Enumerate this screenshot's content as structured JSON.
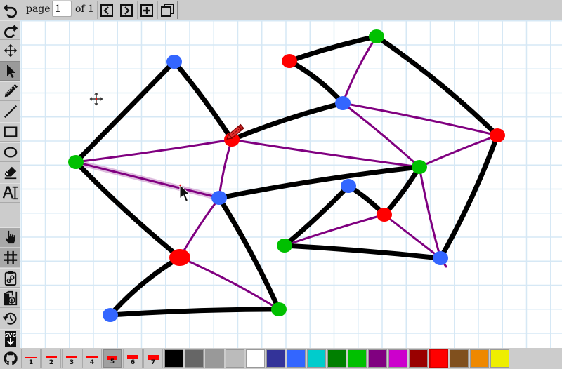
{
  "app": {
    "canvas_background": "#ffffff",
    "grid_color": "#d6e8f5"
  },
  "topbar": {
    "undo_icon": "undo-icon",
    "page_label": "page",
    "page_value": "1",
    "of_label": "of 1",
    "buttons": [
      {
        "name": "previous-page",
        "icon": "chevron-left-icon"
      },
      {
        "name": "next-page",
        "icon": "chevron-right-icon"
      },
      {
        "name": "add-page",
        "icon": "plus-icon"
      },
      {
        "name": "duplicate-page",
        "icon": "copy-icon"
      }
    ]
  },
  "tools": [
    {
      "name": "redo",
      "icon": "redo-icon",
      "state": "normal"
    },
    {
      "name": "pan",
      "icon": "move-icon",
      "state": "normal"
    },
    {
      "name": "select",
      "icon": "pointer-icon",
      "state": "active"
    },
    {
      "name": "pen",
      "icon": "pencil-icon",
      "state": "normal"
    },
    {
      "name": "line",
      "icon": "line-icon",
      "state": "normal"
    },
    {
      "name": "rectangle",
      "icon": "rectangle-icon",
      "state": "normal"
    },
    {
      "name": "ellipse",
      "icon": "ellipse-icon",
      "state": "normal"
    },
    {
      "name": "eraser",
      "icon": "eraser-icon",
      "state": "normal"
    },
    {
      "name": "text",
      "icon": "text-icon",
      "state": "normal"
    },
    {
      "name": "touch-draw",
      "icon": "hand-pointer-icon",
      "state": "toggled"
    },
    {
      "name": "grid",
      "icon": "grid-icon",
      "state": "toggled"
    },
    {
      "name": "share-link",
      "icon": "clipboard-link-icon",
      "state": "normal"
    },
    {
      "name": "add-image",
      "icon": "image-add-icon",
      "state": "normal"
    },
    {
      "name": "history",
      "icon": "history-icon",
      "state": "normal"
    },
    {
      "name": "export-svg",
      "icon": "svg-download-icon",
      "state": "normal",
      "label": "SVG"
    }
  ],
  "bottombar": {
    "github_icon": "github-icon",
    "stroke_widths": [
      {
        "label": "1",
        "active": false
      },
      {
        "label": "2",
        "active": false
      },
      {
        "label": "3",
        "active": false
      },
      {
        "label": "4",
        "active": false
      },
      {
        "label": "5",
        "active": true
      },
      {
        "label": "6",
        "active": false
      },
      {
        "label": "7",
        "active": false
      }
    ],
    "stroke_preview_color": "#ff0000",
    "colors": [
      {
        "hex": "#000000",
        "active": false
      },
      {
        "hex": "#666666",
        "active": false
      },
      {
        "hex": "#999999",
        "active": false
      },
      {
        "hex": "#bbbbbb",
        "active": false
      },
      {
        "hex": "#ffffff",
        "active": false
      },
      {
        "hex": "#333399",
        "active": false
      },
      {
        "hex": "#3366ff",
        "active": false
      },
      {
        "hex": "#00cccc",
        "active": false
      },
      {
        "hex": "#007f00",
        "active": false
      },
      {
        "hex": "#00c000",
        "active": false
      },
      {
        "hex": "#800080",
        "active": false
      },
      {
        "hex": "#cc00cc",
        "active": false
      },
      {
        "hex": "#990000",
        "active": false
      },
      {
        "hex": "#ff0000",
        "active": true
      },
      {
        "hex": "#80501e",
        "active": false
      },
      {
        "hex": "#ee8800",
        "active": false
      },
      {
        "hex": "#eeee00",
        "active": false
      }
    ]
  },
  "drawing": {
    "nodes": [
      {
        "id": "n1",
        "color": "#3366ff"
      },
      {
        "id": "n2",
        "color": "#00c000"
      },
      {
        "id": "n3",
        "color": "#ff0000"
      },
      {
        "id": "n4",
        "color": "#3366ff"
      },
      {
        "id": "n5",
        "color": "#ff0000"
      },
      {
        "id": "n6",
        "color": "#3366ff"
      },
      {
        "id": "n7",
        "color": "#00c000"
      },
      {
        "id": "n8",
        "color": "#ff0000"
      },
      {
        "id": "n9",
        "color": "#00c000"
      },
      {
        "id": "n10",
        "color": "#3366ff"
      },
      {
        "id": "n11",
        "color": "#ff0000"
      },
      {
        "id": "n12",
        "color": "#00c000"
      },
      {
        "id": "n13",
        "color": "#3366ff"
      },
      {
        "id": "n14",
        "color": "#ff0000"
      },
      {
        "id": "n15",
        "color": "#00c000"
      },
      {
        "id": "n16",
        "color": "#3366ff"
      }
    ],
    "black_edges": [
      [
        "n1",
        "n2"
      ],
      [
        "n1",
        "n3"
      ],
      [
        "n2",
        "n5"
      ],
      [
        "n3",
        "n10"
      ],
      [
        "n4",
        "n7"
      ],
      [
        "n4",
        "n12"
      ],
      [
        "n5",
        "n6"
      ],
      [
        "n6",
        "n7"
      ],
      [
        "n8",
        "n9"
      ],
      [
        "n8",
        "n10"
      ],
      [
        "n9",
        "n11"
      ],
      [
        "n11",
        "n16"
      ],
      [
        "n12",
        "n14"
      ],
      [
        "n13",
        "n14"
      ],
      [
        "n13",
        "n15"
      ],
      [
        "n15",
        "n16"
      ]
    ],
    "purple_edges": [
      [
        "n2",
        "n3"
      ],
      [
        "n2",
        "n4"
      ],
      [
        "n3",
        "n4"
      ],
      [
        "n3",
        "n12"
      ],
      [
        "n4",
        "n5"
      ],
      [
        "n5",
        "n7"
      ],
      [
        "n9",
        "n10"
      ],
      [
        "n10",
        "n11"
      ],
      [
        "n10",
        "n12"
      ],
      [
        "n11",
        "n12"
      ],
      [
        "n12",
        "n16"
      ],
      [
        "n14",
        "n15"
      ],
      [
        "n14",
        "n16"
      ]
    ],
    "highlighted_edge": [
      "n2",
      "n4"
    ],
    "black_stroke": "#000000",
    "purple_stroke": "#800080"
  }
}
